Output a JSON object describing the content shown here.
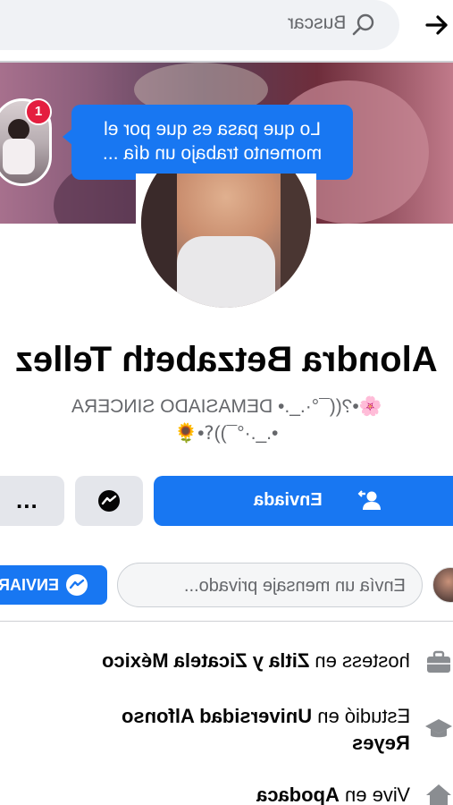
{
  "header": {
    "search_placeholder": "Buscar"
  },
  "cover": {
    "note_text": "Lo que pasa es que por el momento trabajo un día ...",
    "story_badge_count": "1"
  },
  "profile": {
    "name": "Alondra Betzabeth Tellez",
    "bio_line1": "🌸•?((¯°·._.• DEMASIADO SINCERA",
    "bio_line2": "•._.·°¯))؟•🌻"
  },
  "actions": {
    "primary_label": "Enviada",
    "more_label": "..."
  },
  "message": {
    "placeholder": "Envía un mensaje privado...",
    "send_label": "ENVIAR"
  },
  "info": {
    "work_prefix": "hostess en ",
    "work_place": "Zitla y Zicatela México",
    "study_prefix": "Estudió en ",
    "study_place_line1": "Universidad Alfonso",
    "study_place_line2": "Reyes",
    "lives_prefix": "Vive en ",
    "lives_place": "Apodaca"
  },
  "colors": {
    "accent": "#1877f2",
    "badge": "#e41e3f",
    "secondary_bg": "#e4e6eb",
    "muted_text": "#65676b"
  }
}
